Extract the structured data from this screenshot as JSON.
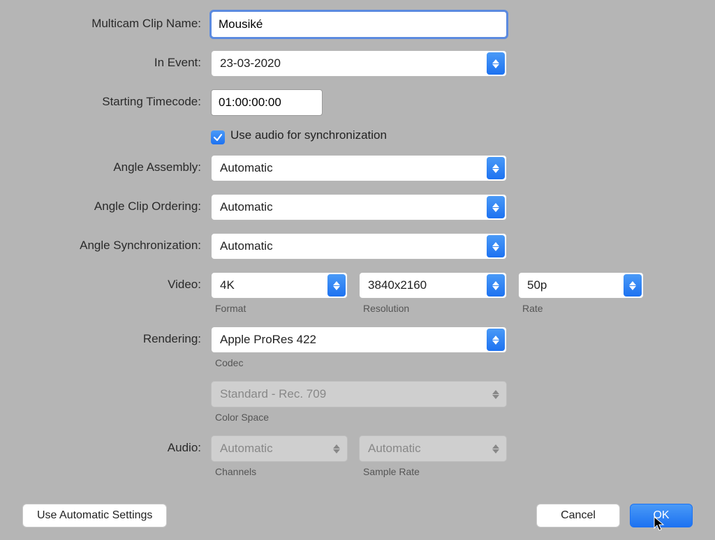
{
  "labels": {
    "clipName": "Multicam Clip Name:",
    "inEvent": "In Event:",
    "startingTimecode": "Starting Timecode:",
    "audioSync": "Use audio for synchronization",
    "angleAssembly": "Angle Assembly:",
    "angleClipOrdering": "Angle Clip Ordering:",
    "angleSync": "Angle Synchronization:",
    "video": "Video:",
    "rendering": "Rendering:",
    "audio": "Audio:"
  },
  "sublabels": {
    "format": "Format",
    "resolution": "Resolution",
    "rate": "Rate",
    "codec": "Codec",
    "colorSpace": "Color Space",
    "channels": "Channels",
    "sampleRate": "Sample Rate"
  },
  "values": {
    "clipName": "Mousiké",
    "inEvent": "23-03-2020",
    "startingTimecode": "01:00:00:00",
    "audioSyncChecked": true,
    "angleAssembly": "Automatic",
    "angleClipOrdering": "Automatic",
    "angleSync": "Automatic",
    "videoFormat": "4K",
    "videoResolution": "3840x2160",
    "videoRate": "50p",
    "renderingCodec": "Apple ProRes 422",
    "colorSpace": "Standard - Rec. 709",
    "audioChannels": "Automatic",
    "audioSampleRate": "Automatic"
  },
  "buttons": {
    "autoSettings": "Use Automatic Settings",
    "cancel": "Cancel",
    "ok": "OK"
  }
}
